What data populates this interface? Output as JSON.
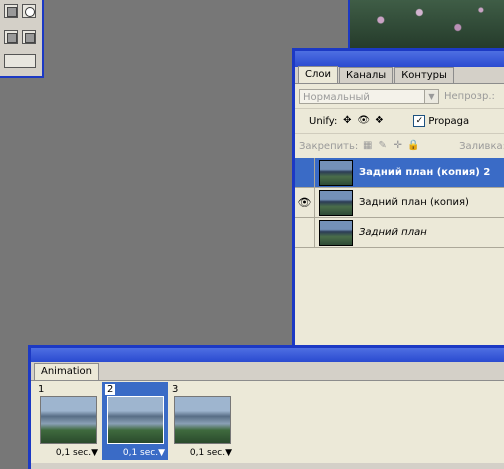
{
  "layers_panel": {
    "tabs": [
      "Слои",
      "Каналы",
      "Контуры"
    ],
    "blend_mode": "Нормальный",
    "opacity_label": "Непрозр.:",
    "unify_label": "Unify:",
    "propagate_label": "Propaga",
    "lock_label": "Закрепить:",
    "fill_label": "Заливка:",
    "layers": [
      {
        "name": "Задний план (копия) 2",
        "visible": false,
        "selected": true
      },
      {
        "name": "Задний план (копия)",
        "visible": true,
        "selected": false
      },
      {
        "name": "Задний план",
        "visible": false,
        "selected": false
      }
    ]
  },
  "animation_panel": {
    "tab": "Animation",
    "frames": [
      {
        "number": "1",
        "delay": "0,1 sec."
      },
      {
        "number": "2",
        "delay": "0,1 sec."
      },
      {
        "number": "3",
        "delay": "0,1 sec."
      }
    ]
  },
  "colors": {
    "accent": "#1c39c4",
    "selection": "#3a6bc6",
    "panel_bg": "#ece9d8",
    "workspace": "#777777"
  }
}
